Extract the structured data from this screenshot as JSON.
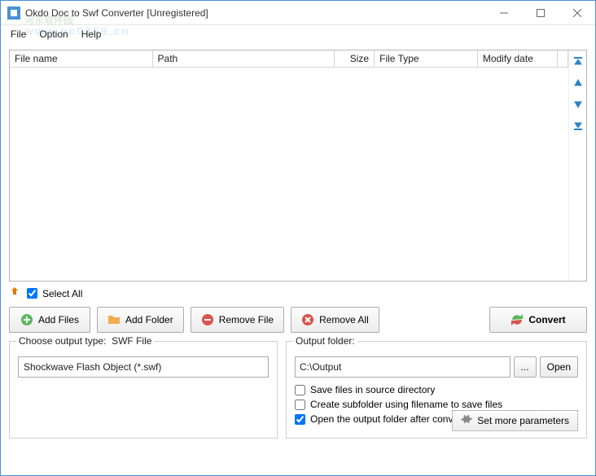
{
  "window": {
    "title": "Okdo Doc to Swf Converter [Unregistered]"
  },
  "menu": {
    "file": "File",
    "option": "Option",
    "help": "Help"
  },
  "watermark": {
    "main": "河东软件园",
    "sub": "www.pc0359.cn"
  },
  "table": {
    "headers": {
      "filename": "File name",
      "path": "Path",
      "size": "Size",
      "filetype": "File Type",
      "modifydate": "Modify date"
    },
    "rows": []
  },
  "select_all": {
    "label": "Select All",
    "checked": true
  },
  "buttons": {
    "add_files": "Add Files",
    "add_folder": "Add Folder",
    "remove_file": "Remove File",
    "remove_all": "Remove All",
    "convert": "Convert"
  },
  "output_type": {
    "label": "Choose output type:",
    "value_label": "SWF File",
    "option": "Shockwave Flash Object (*.swf)"
  },
  "output_folder": {
    "label": "Output folder:",
    "path": "C:\\Output",
    "browse": "...",
    "open": "Open"
  },
  "options": {
    "save_source": {
      "label": "Save files in source directory",
      "checked": false
    },
    "create_subfolder": {
      "label": "Create subfolder using filename to save files",
      "checked": false
    },
    "open_after": {
      "label": "Open the output folder after conversion finished",
      "checked": true
    }
  },
  "more_params": "Set more parameters"
}
